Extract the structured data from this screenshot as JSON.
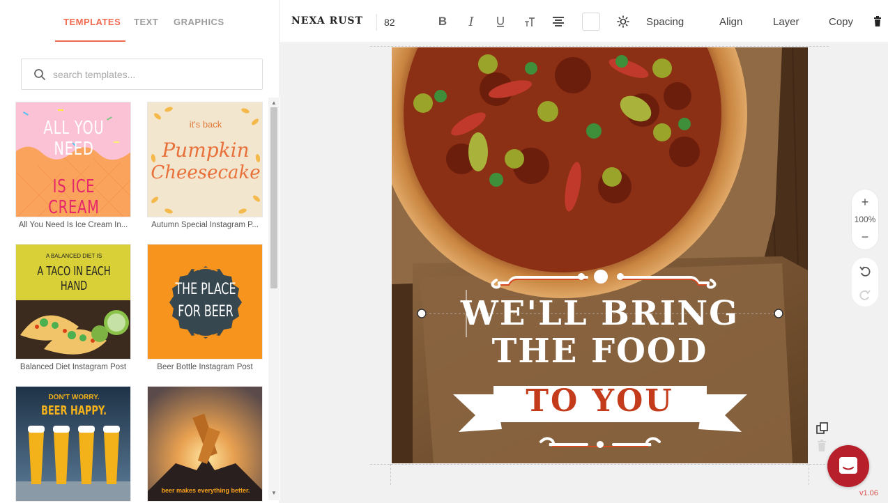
{
  "left_panel": {
    "tabs": [
      {
        "label": "TEMPLATES",
        "active": true
      },
      {
        "label": "TEXT",
        "active": false
      },
      {
        "label": "GRAPHICS",
        "active": false
      }
    ],
    "search": {
      "placeholder": "search templates..."
    },
    "templates": [
      {
        "label": "All You Need Is Ice Cream In...",
        "thumb_line1": "ALL YOU NEED",
        "thumb_line2": "IS ICE CREAM"
      },
      {
        "label": "Autumn Special Instagram P...",
        "thumb_line1": "it's back",
        "thumb_line2": "Pumpkin",
        "thumb_line3": "Cheesecake"
      },
      {
        "label": "Balanced Diet Instagram Post",
        "thumb_line1": "A BALANCED DIET IS",
        "thumb_line2": "A TACO IN EACH HAND"
      },
      {
        "label": "Beer Bottle Instagram Post",
        "thumb_line1": "THE PLACE",
        "thumb_line2": "FOR BEER"
      },
      {
        "label": "",
        "thumb_line1": "DON'T WORRY.",
        "thumb_line2": "BEER HAPPY."
      },
      {
        "label": "",
        "thumb_line1": "beer makes everything better."
      }
    ]
  },
  "toolbar": {
    "font_name": "NEXA RUST",
    "font_size": "82",
    "spacing": "Spacing",
    "align": "Align",
    "layer": "Layer",
    "copy": "Copy"
  },
  "canvas": {
    "line1": "WE'LL BRING",
    "line2": "THE FOOD",
    "line3": "TO YOU"
  },
  "zoom": {
    "level": "100%"
  },
  "version": "v1.06",
  "colors": {
    "accent": "#f06a50",
    "banner_text": "#c33b1a",
    "chat": "#b71f2a"
  }
}
